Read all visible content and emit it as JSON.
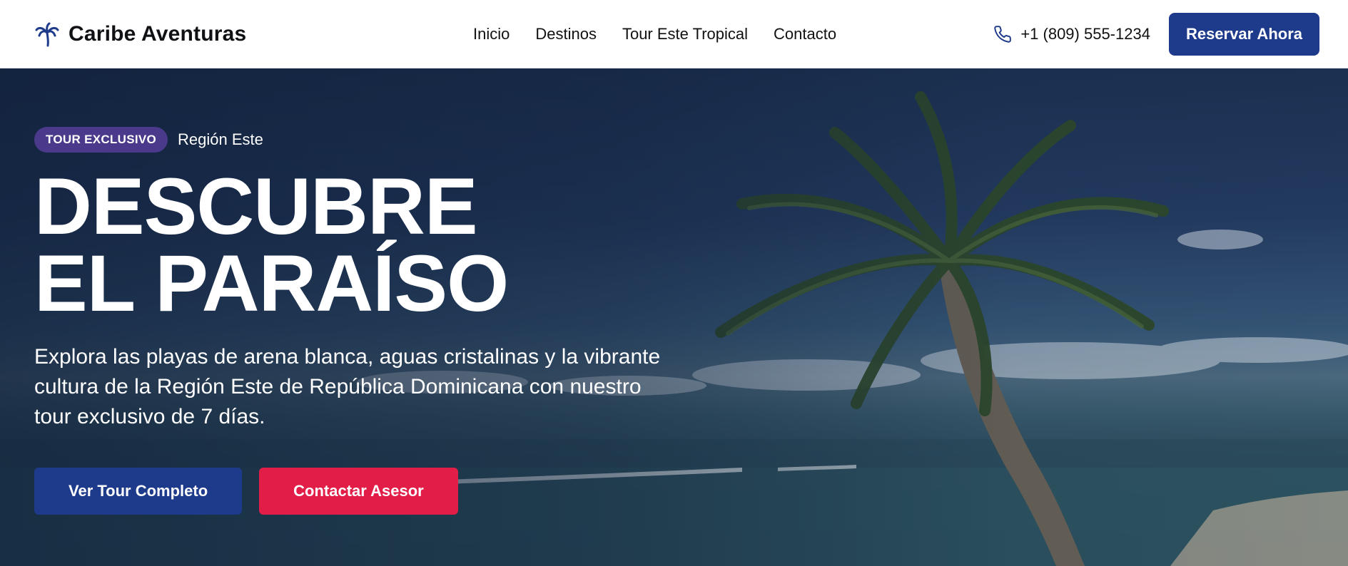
{
  "brand": {
    "name": "Caribe Aventuras",
    "icon": "palm-tree-icon"
  },
  "nav": {
    "items": [
      {
        "label": "Inicio"
      },
      {
        "label": "Destinos"
      },
      {
        "label": "Tour Este Tropical"
      },
      {
        "label": "Contacto"
      }
    ]
  },
  "contact": {
    "phone": "+1 (809) 555-1234",
    "icon": "phone-icon"
  },
  "header": {
    "reserve_label": "Reservar Ahora"
  },
  "hero": {
    "badge": "TOUR EXCLUSIVO",
    "region": "Región Este",
    "title_line1": "DESCUBRE",
    "title_line2": "EL PARAÍSO",
    "subtitle": "Explora las playas de arena blanca, aguas cristalinas y la vibrante cultura de la Región Este de República Dominicana con nuestro tour exclusivo de 7 días.",
    "primary_cta": "Ver Tour Completo",
    "secondary_cta": "Contactar Asesor"
  },
  "colors": {
    "primary": "#1e3a8a",
    "accent": "#e11d48",
    "badge": "#4b3a8c"
  }
}
